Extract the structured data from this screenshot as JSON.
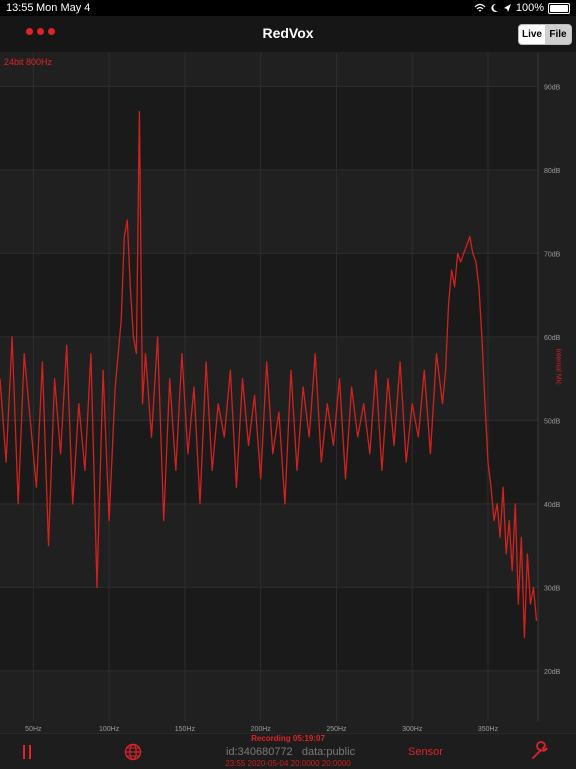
{
  "status": {
    "time": "13:55",
    "date": "Mon May 4",
    "battery": "100%"
  },
  "header": {
    "title": "RedVox",
    "segments": [
      "Live",
      "File"
    ],
    "selected": "Live"
  },
  "plot": {
    "bitrate": "24bit 800Hz",
    "side_label": "Internal Mic"
  },
  "chart_data": {
    "type": "line",
    "title": "",
    "xlabel": "",
    "ylabel": "Internal Mic",
    "xlim": [
      28,
      383
    ],
    "ylim": [
      14,
      94
    ],
    "x_ticks": [
      50,
      100,
      150,
      200,
      250,
      300,
      350
    ],
    "x_tick_labels": [
      "50Hz",
      "100Hz",
      "150Hz",
      "200Hz",
      "250Hz",
      "300Hz",
      "350Hz"
    ],
    "y_ticks": [
      20,
      30,
      40,
      50,
      60,
      70,
      80,
      90
    ],
    "y_tick_labels": [
      "20dB",
      "30dB",
      "40dB",
      "50dB",
      "60dB",
      "70dB",
      "80dB",
      "90dB"
    ],
    "grid": true,
    "series": [
      {
        "color": "#d0231f",
        "x": [
          28,
          32,
          36,
          40,
          44,
          48,
          52,
          56,
          60,
          64,
          68,
          72,
          76,
          80,
          84,
          88,
          92,
          96,
          100,
          104,
          108,
          110,
          112,
          114,
          116,
          118,
          120,
          122,
          124,
          128,
          132,
          136,
          140,
          144,
          148,
          152,
          156,
          160,
          164,
          168,
          172,
          176,
          180,
          184,
          188,
          192,
          196,
          200,
          204,
          208,
          212,
          216,
          220,
          224,
          228,
          232,
          236,
          240,
          244,
          248,
          252,
          256,
          260,
          264,
          268,
          272,
          276,
          280,
          284,
          288,
          292,
          296,
          300,
          304,
          308,
          312,
          316,
          320,
          322,
          324,
          326,
          328,
          330,
          332,
          334,
          336,
          338,
          340,
          342,
          344,
          346,
          348,
          350,
          352,
          354,
          356,
          358,
          360,
          362,
          364,
          366,
          368,
          370,
          372,
          374,
          376,
          378,
          380,
          382
        ],
        "y": [
          55,
          45,
          60,
          40,
          58,
          50,
          42,
          57,
          35,
          55,
          46,
          59,
          40,
          52,
          44,
          58,
          30,
          56,
          38,
          54,
          62,
          72,
          74,
          66,
          60,
          58,
          87,
          52,
          58,
          48,
          60,
          38,
          55,
          44,
          58,
          46,
          54,
          40,
          57,
          44,
          52,
          48,
          56,
          42,
          55,
          47,
          53,
          43,
          57,
          46,
          51,
          40,
          56,
          44,
          54,
          48,
          58,
          45,
          52,
          47,
          55,
          43,
          54,
          48,
          52,
          46,
          56,
          44,
          55,
          47,
          57,
          45,
          52,
          48,
          56,
          46,
          58,
          52,
          56,
          64,
          68,
          66,
          70,
          69,
          70,
          71,
          72,
          70,
          69,
          66,
          60,
          52,
          45,
          42,
          38,
          40,
          36,
          42,
          34,
          38,
          32,
          40,
          28,
          36,
          24,
          34,
          28,
          30,
          26
        ]
      }
    ]
  },
  "footer": {
    "recording": "Recording 05:19:07",
    "id": "id:340680772",
    "data": "data:public",
    "timestamp": "23:55 2020-05-04 20:0000 20:0000",
    "sensor": "Sensor"
  }
}
